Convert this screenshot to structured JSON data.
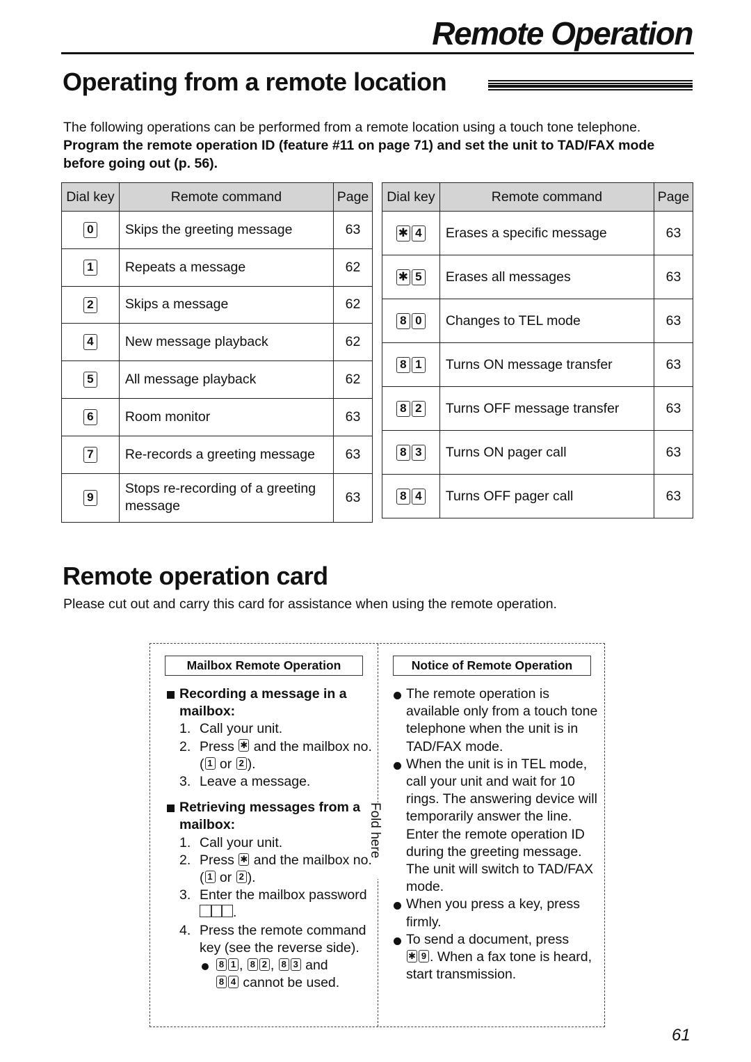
{
  "header": {
    "title": "Remote Operation"
  },
  "section1": {
    "title": "Operating from a remote location",
    "intro": "The following operations can be performed from a remote location using a touch tone telephone.",
    "intro_bold": "Program the remote operation ID (feature #11 on page 71) and set the unit to TAD/FAX mode before going out (p. 56)."
  },
  "table_headers": {
    "dial_key": "Dial key",
    "command": "Remote command",
    "page": "Page"
  },
  "table_left": [
    {
      "keys": [
        "0"
      ],
      "command": "Skips the greeting message",
      "page": "63"
    },
    {
      "keys": [
        "1"
      ],
      "command": "Repeats a message",
      "page": "62"
    },
    {
      "keys": [
        "2"
      ],
      "command": "Skips a message",
      "page": "62"
    },
    {
      "keys": [
        "4"
      ],
      "command": "New message playback",
      "page": "62"
    },
    {
      "keys": [
        "5"
      ],
      "command": "All message playback",
      "page": "62"
    },
    {
      "keys": [
        "6"
      ],
      "command": "Room monitor",
      "page": "63"
    },
    {
      "keys": [
        "7"
      ],
      "command": "Re-records a greeting message",
      "page": "63"
    },
    {
      "keys": [
        "9"
      ],
      "command": "Stops re-recording of a greeting message",
      "page": "63"
    }
  ],
  "table_right": [
    {
      "keys": [
        "✱",
        "4"
      ],
      "command": "Erases a specific message",
      "page": "63"
    },
    {
      "keys": [
        "✱",
        "5"
      ],
      "command": "Erases all messages",
      "page": "63"
    },
    {
      "keys": [
        "8",
        "0"
      ],
      "command": "Changes to TEL mode",
      "page": "63"
    },
    {
      "keys": [
        "8",
        "1"
      ],
      "command": "Turns ON message transfer",
      "page": "63"
    },
    {
      "keys": [
        "8",
        "2"
      ],
      "command": "Turns OFF message transfer",
      "page": "63"
    },
    {
      "keys": [
        "8",
        "3"
      ],
      "command": "Turns ON pager call",
      "page": "63"
    },
    {
      "keys": [
        "8",
        "4"
      ],
      "command": "Turns OFF pager call",
      "page": "63"
    }
  ],
  "section2": {
    "title": "Remote operation card",
    "intro": "Please cut out and carry this card for assistance when using the remote operation."
  },
  "card": {
    "fold_label": "Fold here",
    "left": {
      "heading": "Mailbox Remote Operation",
      "recording": {
        "title": "Recording a message in a mailbox:",
        "step1": "Call your unit.",
        "step2_a": "Press",
        "step2_b": "and the mailbox no. (",
        "step2_or": "or",
        "step2_end": ").",
        "step3": "Leave a message."
      },
      "retrieving": {
        "title": "Retrieving messages from a mailbox:",
        "step1": "Call your unit.",
        "step2_a": "Press",
        "step2_b": "and the mailbox no. (",
        "step2_or": "or",
        "step2_end": ").",
        "step3": "Enter the mailbox password",
        "step4": "Press the remote command key (see the reverse side).",
        "note_and": "and",
        "note_end": "cannot be used."
      },
      "keys": {
        "star": "✱",
        "one": "1",
        "two": "2",
        "three": "3",
        "four": "4",
        "eight": "8",
        "nine": "9"
      }
    },
    "right": {
      "heading": "Notice of Remote Operation",
      "notices": [
        "The remote operation is available only from a touch tone telephone when the unit is in TAD/FAX mode.",
        "When the unit is in TEL mode, call your unit and wait for 10 rings. The answering device will temporarily answer the line. Enter the remote operation ID during the greeting message.",
        "The unit will switch to TAD/FAX mode.",
        "When you press a key, press firmly.",
        "To send a document, press",
        ". When a fax tone is heard, start transmission."
      ]
    }
  },
  "page_number": "61"
}
